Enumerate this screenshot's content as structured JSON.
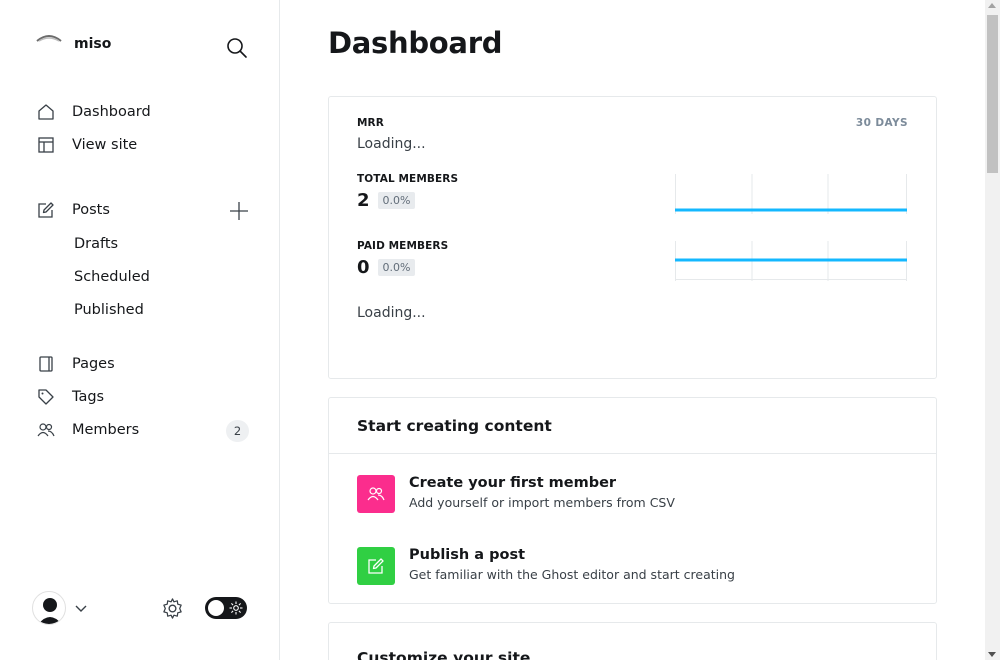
{
  "brand": {
    "name": "miso"
  },
  "sidebar": {
    "nav": [
      {
        "label": "Dashboard",
        "icon": "home-icon"
      },
      {
        "label": "View site",
        "icon": "layout-icon"
      }
    ],
    "posts": {
      "label": "Posts",
      "icon": "edit-icon",
      "sub": [
        "Drafts",
        "Scheduled",
        "Published"
      ]
    },
    "nav2": [
      {
        "label": "Pages",
        "icon": "page-icon"
      },
      {
        "label": "Tags",
        "icon": "tag-icon"
      },
      {
        "label": "Members",
        "icon": "members-icon",
        "count": "2"
      }
    ]
  },
  "main": {
    "title": "Dashboard",
    "metrics": {
      "mrr_label": "MRR",
      "mrr_value": "Loading...",
      "range": "30 DAYS",
      "total_label": "TOTAL MEMBERS",
      "total_value": "2",
      "total_change": "0.0%",
      "paid_label": "PAID MEMBERS",
      "paid_value": "0",
      "paid_change": "0.0%",
      "bottom_loading": "Loading..."
    },
    "start": {
      "title": "Start creating content",
      "tasks": [
        {
          "title": "Create your first member",
          "desc": "Add yourself or import members from CSV",
          "color": "#fb2d8d"
        },
        {
          "title": "Publish a post",
          "desc": "Get familiar with the Ghost editor and start creating",
          "color": "#30cf43"
        }
      ]
    },
    "customize": {
      "title": "Customize your site"
    }
  },
  "colors": {
    "accent_line": "#14b8ff"
  }
}
